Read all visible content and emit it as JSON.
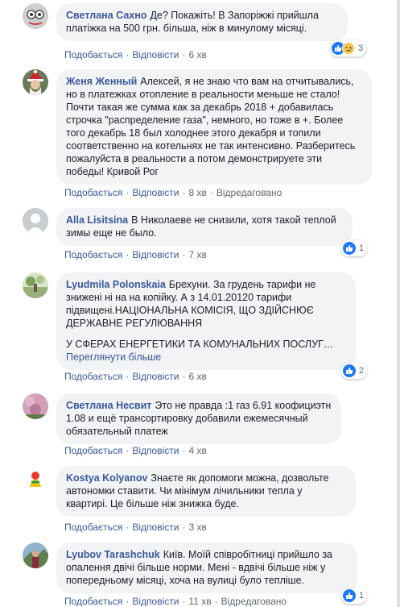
{
  "actions": {
    "like": "Подобається",
    "reply": "Відповісти",
    "edited": "Відредаговано",
    "sep": "·"
  },
  "comments": [
    {
      "author": "Светлана Сахно",
      "text": "Де? Покажіть! В Запоріжжі прийшла платіжка на 500 грн. більша, ніж в минулому місяці.",
      "time": "6 хв",
      "reactions": {
        "count": "3",
        "types": [
          "like-icon",
          "sad-icon"
        ]
      }
    },
    {
      "author": "Женя Женный",
      "text": "Алексей, я не знаю что вам на отчитывались, но в платежках отопление в реальности меньше не стало! Почти такая же сумма как за декабрь 2018 + добавилась строчка \"распределение газа\", немного, но тоже в +. Более того декабрь 18 был холоднее этого декабря и топили соответственно на котельнях не так интенсивно. Разберитесь пожалуйста в реальности а потом демонстрируете эти победы! Кривой Рог",
      "time": "8 хв",
      "edited": true
    },
    {
      "author": "Alla Lisitsina",
      "text": "В Николаеве не снизили, хотя такой теплой зимы еще не было.",
      "time": "7 хв",
      "reactions": {
        "count": "1",
        "types": [
          "like-icon"
        ]
      }
    },
    {
      "author": "Lyudmila Polonskaia",
      "text": "Брехуни. За грудень тарифи не знижені ні на на копійку. А з 14.01.20120 тарифи підвищені.НАЦІОНАЛЬНА КОМІСІЯ, ЩО ЗДІЙСНЮЄ ДЕРЖАВНЕ РЕГУЛЮВАННЯ",
      "text2": "У СФЕРАХ ЕНЕРГЕТИКИ ТА КОМУНАЛЬНИХ ПОСЛУГ…",
      "see_more": "Переглянути більше",
      "time": "6 хв",
      "reactions": {
        "count": "2",
        "types": [
          "like-icon"
        ]
      }
    },
    {
      "author": "Светлана Несвит",
      "text": "Это не правда :1 газ 6.91 коофициэтн 1.08 и ещё трансортировку добавили ежемесячный обязательный платеж",
      "time": "4 хв"
    },
    {
      "author": "Kostya Kolyanov",
      "text": "Знаєте як допомоги можна, дозвольте автономки ставити. Чи мінімум лічильники тепла у квартирі. Це більше ніж знижка буде.",
      "time": "3 хв"
    },
    {
      "author": "Lyubov Tarashchuk",
      "text": "Київ. Моїй співробітниці прийшло за опалення двічі більше норми. Мені - вдвічі більше ніж у попередньому місяці, хоча на вулиці було тепліше.",
      "time": "11 хв",
      "edited": true,
      "reactions": {
        "count": "1",
        "types": [
          "like-icon"
        ]
      }
    }
  ]
}
